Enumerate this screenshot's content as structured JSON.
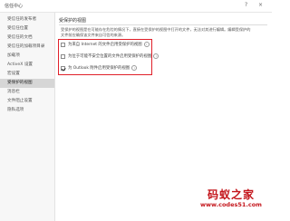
{
  "window": {
    "title": "信任中心",
    "help_label": "?",
    "close_label": "×"
  },
  "sidebar": {
    "items": [
      {
        "label": "受信任的发布者",
        "active": false
      },
      {
        "label": "受信任位置",
        "active": false
      },
      {
        "label": "受信任的文档",
        "active": false
      },
      {
        "label": "受信任的加载项目录",
        "active": false
      },
      {
        "label": "加载项",
        "active": false
      },
      {
        "label": "ActiveX 设置",
        "active": false
      },
      {
        "label": "宏设置",
        "active": false
      },
      {
        "label": "受保护的视图",
        "active": true
      },
      {
        "label": "消息栏",
        "active": false
      },
      {
        "label": "文件阻止设置",
        "active": false
      },
      {
        "label": "隐私选项",
        "active": false
      }
    ]
  },
  "main": {
    "section_title": "受保护的视图",
    "description_line1": "受保护的视图是在可能存在危险的情况下，直接在受保护的视图中打开的文件，无法对其进行编辑。编辑受保护的",
    "description_line2": "文件前应确保该文件来自可信的来源。",
    "options": [
      {
        "label": "为来自 Internet 的文件启用受保护的视图",
        "checked": false
      },
      {
        "label": "为位于可能不安全位置的文件启用受保护的视图",
        "checked": false
      },
      {
        "label": "为 Outlook 附件启用受保护的视图",
        "checked": true
      }
    ]
  },
  "watermark": {
    "title": "码蚁之家",
    "url": "www.codes51.com"
  }
}
